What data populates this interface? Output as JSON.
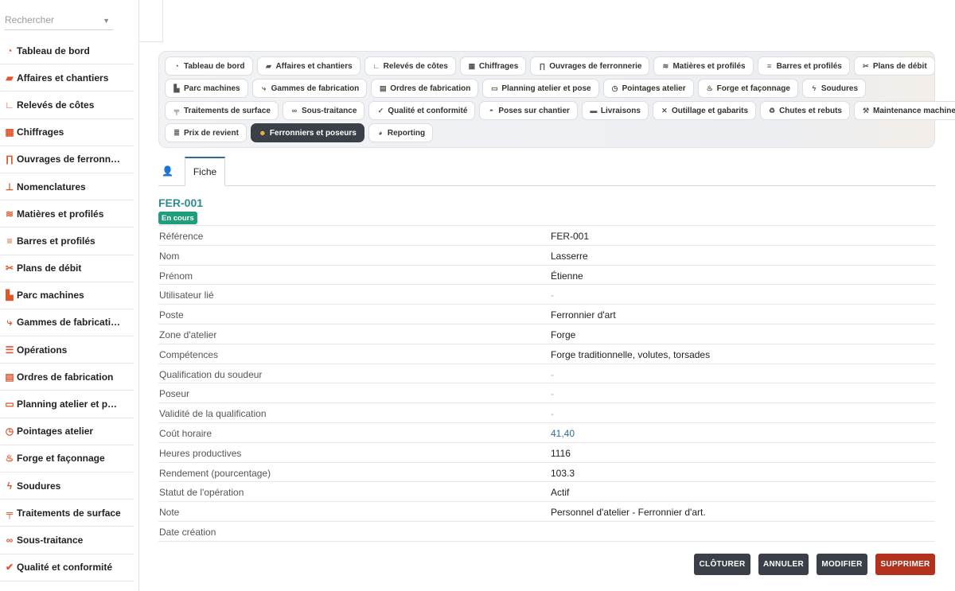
{
  "search": {
    "placeholder": "Rechercher"
  },
  "sidebar": {
    "items": [
      {
        "label": "Tableau de bord",
        "icon": "gauge-icon"
      },
      {
        "label": "Affaires et chantiers",
        "icon": "briefcase-icon"
      },
      {
        "label": "Relevés de côtes",
        "icon": "ruler-icon"
      },
      {
        "label": "Chiffrages",
        "icon": "calculator-icon"
      },
      {
        "label": "Ouvrages de ferronn…",
        "icon": "gate-icon"
      },
      {
        "label": "Nomenclatures",
        "icon": "sitemap-icon"
      },
      {
        "label": "Matières et profilés",
        "icon": "layers-icon"
      },
      {
        "label": "Barres et profilés",
        "icon": "bars-icon"
      },
      {
        "label": "Plans de débit",
        "icon": "scissors-icon"
      },
      {
        "label": "Parc machines",
        "icon": "factory-icon"
      },
      {
        "label": "Gammes de fabricati…",
        "icon": "flow-icon"
      },
      {
        "label": "Opérations",
        "icon": "list-icon"
      },
      {
        "label": "Ordres de fabrication",
        "icon": "clipboard-icon"
      },
      {
        "label": "Planning atelier et p…",
        "icon": "calendar-icon"
      },
      {
        "label": "Pointages atelier",
        "icon": "clock-icon"
      },
      {
        "label": "Forge et façonnage",
        "icon": "fire-icon"
      },
      {
        "label": "Soudures",
        "icon": "bolt-icon"
      },
      {
        "label": "Traitements de surface",
        "icon": "paint-roller-icon"
      },
      {
        "label": "Sous-traitance",
        "icon": "handshake-icon"
      },
      {
        "label": "Qualité et conformité",
        "icon": "check-badge-icon"
      }
    ]
  },
  "modules": {
    "rows": [
      [
        {
          "label": "Tableau de bord",
          "icon": "gauge-icon",
          "glyph": "◔"
        },
        {
          "label": "Affaires et chantiers",
          "icon": "briefcase-icon",
          "glyph": "▰"
        },
        {
          "label": "Relevés de côtes",
          "icon": "ruler-icon",
          "glyph": "∟"
        },
        {
          "label": "Chiffrages",
          "icon": "calculator-icon",
          "glyph": "▦"
        },
        {
          "label": "Ouvrages de ferronnerie",
          "icon": "gate-icon",
          "glyph": "∏"
        },
        {
          "label": "Matières et profilés",
          "icon": "layers-icon",
          "glyph": "≋"
        },
        {
          "label": "Barres et profilés",
          "icon": "bars-icon",
          "glyph": "≡"
        },
        {
          "label": "Plans de débit",
          "icon": "scissors-icon",
          "glyph": "✂"
        }
      ],
      [
        {
          "label": "Parc machines",
          "icon": "factory-icon",
          "glyph": "▙"
        },
        {
          "label": "Gammes de fabrication",
          "icon": "flow-icon",
          "glyph": "⤷"
        },
        {
          "label": "Ordres de fabrication",
          "icon": "clipboard-icon",
          "glyph": "▤"
        },
        {
          "label": "Planning atelier et pose",
          "icon": "calendar-icon",
          "glyph": "▭"
        },
        {
          "label": "Pointages atelier",
          "icon": "clock-icon",
          "glyph": "◷"
        },
        {
          "label": "Forge et façonnage",
          "icon": "fire-icon",
          "glyph": "♨"
        },
        {
          "label": "Soudures",
          "icon": "bolt-icon",
          "glyph": "ϟ"
        }
      ],
      [
        {
          "label": "Traitements de surface",
          "icon": "paint-roller-icon",
          "glyph": "╤"
        },
        {
          "label": "Sous-traitance",
          "icon": "handshake-icon",
          "glyph": "∞"
        },
        {
          "label": "Qualité et conformité",
          "icon": "check-badge-icon",
          "glyph": "✓"
        },
        {
          "label": "Poses sur chantier",
          "icon": "helmet-icon",
          "glyph": "◓"
        },
        {
          "label": "Livraisons",
          "icon": "truck-icon",
          "glyph": "▬"
        },
        {
          "label": "Outillage et gabarits",
          "icon": "tools-icon",
          "glyph": "✕"
        },
        {
          "label": "Chutes et rebuts",
          "icon": "recycle-icon",
          "glyph": "♻"
        },
        {
          "label": "Maintenance machines",
          "icon": "wrench-icon",
          "glyph": "⚒"
        }
      ],
      [
        {
          "label": "Prix de revient",
          "icon": "coins-icon",
          "glyph": "≣"
        },
        {
          "label": "Ferronniers et poseurs",
          "icon": "users-icon",
          "glyph": "☻",
          "active": true
        },
        {
          "label": "Reporting",
          "icon": "pie-chart-icon",
          "glyph": "◕"
        }
      ]
    ]
  },
  "tabs": {
    "icon": "user-gear-icon",
    "active_label": "Fiche"
  },
  "record": {
    "title": "FER-001",
    "status": "En cours",
    "fields": [
      {
        "label": "Référence",
        "value": "FER-001"
      },
      {
        "label": "Nom",
        "value": "Lasserre"
      },
      {
        "label": "Prénom",
        "value": "Étienne"
      },
      {
        "label": "Utilisateur lié",
        "value": "-"
      },
      {
        "label": "Poste",
        "value": "Ferronnier d'art"
      },
      {
        "label": "Zone d'atelier",
        "value": "Forge"
      },
      {
        "label": "Compétences",
        "value": "Forge traditionnelle, volutes, torsades"
      },
      {
        "label": "Qualification du soudeur",
        "value": "-"
      },
      {
        "label": "Poseur",
        "value": "-"
      },
      {
        "label": "Validité de la qualification",
        "value": "-"
      },
      {
        "label": "Coût horaire",
        "value": "41,40"
      },
      {
        "label": "Heures productives",
        "value": "1116"
      },
      {
        "label": "Rendement (pourcentage)",
        "value": "103.3"
      },
      {
        "label": "Statut de l'opération",
        "value": "Actif"
      },
      {
        "label": "Note",
        "value": "Personnel d'atelier - Ferronnier d'art."
      },
      {
        "label": "Date création",
        "value": ""
      }
    ]
  },
  "actions": {
    "close_label": "CLÔTURER",
    "cancel_label": "ANNULER",
    "edit_label": "MODIFIER",
    "delete_label": "SUPPRIMER"
  },
  "colors": {
    "accent": "#e0552a",
    "title_teal": "#2f8a8f",
    "status_green": "#1e9e7a",
    "dark_button": "#3b4048",
    "danger": "#b3321d"
  }
}
